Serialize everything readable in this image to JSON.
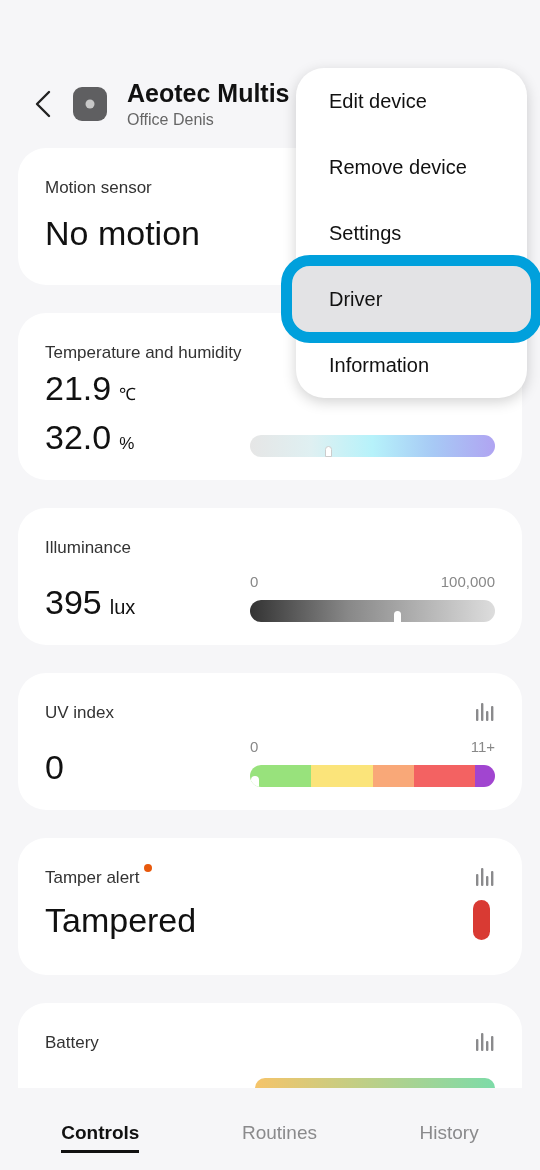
{
  "header": {
    "title": "Aeotec Multis",
    "subtitle": "Office Denis"
  },
  "cards": [
    {
      "kind": "status",
      "title": "Motion sensor",
      "value": "No motion"
    },
    {
      "kind": "temp_humidity",
      "title": "Temperature and humidity",
      "readings": [
        {
          "value": "21.9",
          "unit": "℃"
        },
        {
          "value": "32.0",
          "unit": "%"
        }
      ],
      "level": 0.32
    },
    {
      "kind": "range",
      "title": "Illuminance",
      "value": "395",
      "unit": "lux",
      "min_label": "0",
      "max_label": "100,000",
      "level": 0.6
    },
    {
      "kind": "uv",
      "title": "UV index",
      "value": "0",
      "min_label": "0",
      "max_label": "11+",
      "level": 0,
      "history": true
    },
    {
      "kind": "alert",
      "title": "Tamper alert",
      "value": "Tampered",
      "new": true,
      "alert": true,
      "history": true
    },
    {
      "kind": "battery",
      "title": "Battery",
      "history": true
    }
  ],
  "menu": [
    {
      "label": "Edit device",
      "selected": false
    },
    {
      "label": "Remove device",
      "selected": false
    },
    {
      "label": "Settings",
      "selected": false
    },
    {
      "label": "Driver",
      "selected": true
    },
    {
      "label": "Information",
      "selected": false
    }
  ],
  "tabs": [
    {
      "label": "Controls",
      "selected": true
    },
    {
      "label": "Routines",
      "selected": false
    },
    {
      "label": "History",
      "selected": false
    }
  ]
}
